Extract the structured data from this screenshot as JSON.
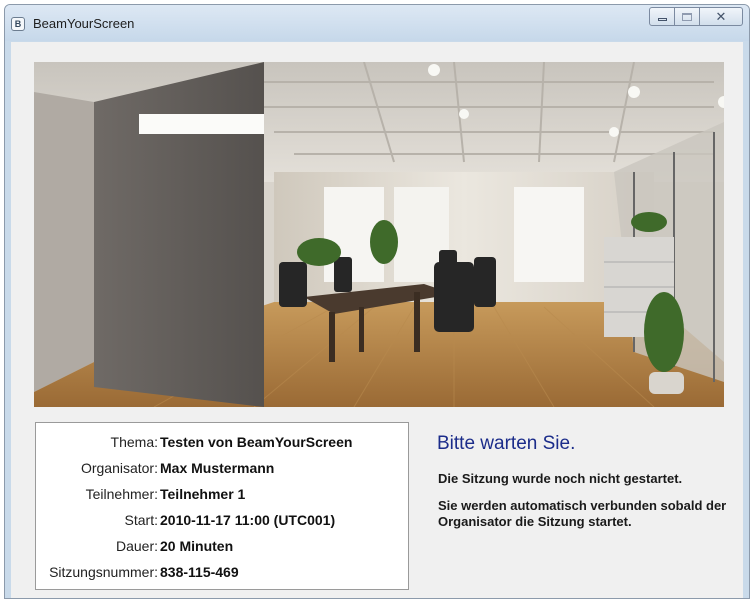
{
  "window": {
    "title": "BeamYourScreen",
    "icon": "beamyourscreen-app-icon",
    "controls": [
      "minimize",
      "maximize",
      "close"
    ]
  },
  "image": {
    "description_icon": "conference-room-photo"
  },
  "session_info": {
    "rows": [
      {
        "label": "Thema:",
        "value": "Testen von BeamYourScreen"
      },
      {
        "label": "Organisator:",
        "value": "Max Mustermann"
      },
      {
        "label": "Teilnehmer:",
        "value": "Teilnehmer 1"
      },
      {
        "label": "Start:",
        "value": "2010-11-17 11:00 (UTC001)"
      },
      {
        "label": "Dauer:",
        "value": "20 Minuten"
      },
      {
        "label": "Sitzungsnummer:",
        "value": "838-115-469"
      }
    ]
  },
  "status": {
    "title": "Bitte warten Sie.",
    "message1": "Die Sitzung wurde noch nicht gestartet.",
    "message2": "Sie werden automatisch verbunden sobald der Organisator die Sitzung startet."
  },
  "colors": {
    "title_text": "#1b2c8a",
    "window_frame": "#c9daea",
    "client_bg": "#f0f0f0"
  }
}
